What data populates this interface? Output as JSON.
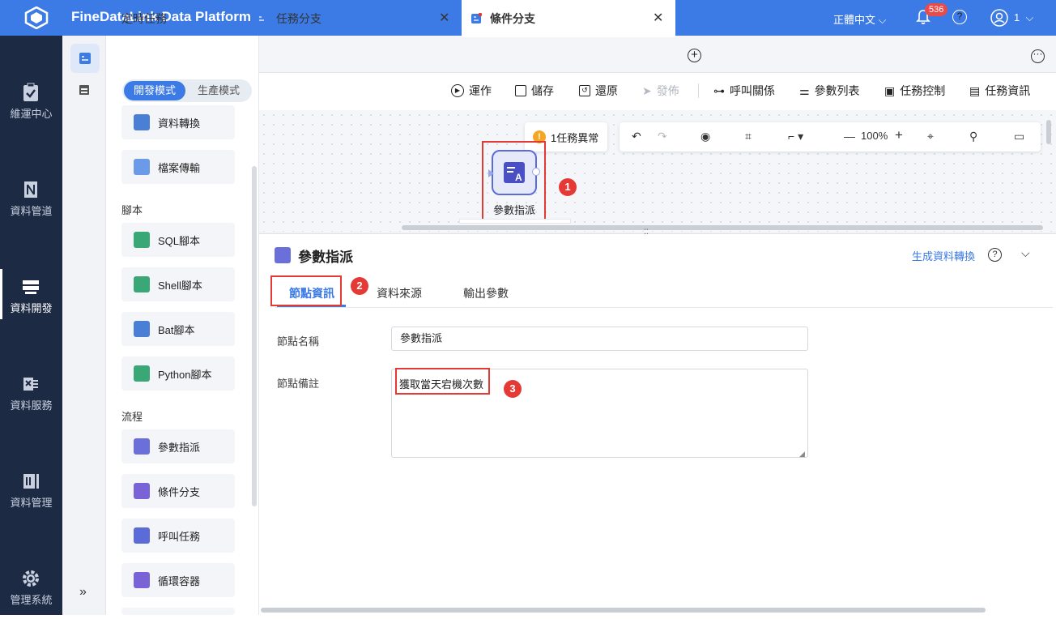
{
  "app": {
    "title": "FineDataLink Data Platform",
    "language": "正體中文",
    "notifications": "536",
    "user_number": "1"
  },
  "nav": [
    {
      "label": "維運中心",
      "icon": "clipboard-check-icon"
    },
    {
      "label": "資料管道",
      "icon": "pipeline-icon"
    },
    {
      "label": "資料開發",
      "icon": "dev-icon"
    },
    {
      "label": "資料服務",
      "icon": "service-icon"
    },
    {
      "label": "資料管理",
      "icon": "data-manage-icon"
    },
    {
      "label": "管理系統",
      "icon": "gear-icon"
    }
  ],
  "tabs": {
    "scheduled": "定時任務",
    "tab1": "任務分支",
    "tab2": "條件分支"
  },
  "modes": {
    "dev": "開發模式",
    "prod": "生產模式"
  },
  "toolbar": {
    "run": "運作",
    "save": "儲存",
    "restore": "還原",
    "publish": "發佈",
    "call_relation": "呼叫關係",
    "param_list": "參數列表",
    "task_control": "任務控制",
    "task_info": "任務資訊"
  },
  "palette": {
    "top": [
      "資料轉換",
      "檔案傳輸"
    ],
    "script_section": "腳本",
    "scripts": [
      "SQL腳本",
      "Shell腳本",
      "Bat腳本",
      "Python腳本"
    ],
    "flow_section": "流程",
    "flows": [
      "參數指派",
      "條件分支",
      "呼叫任務",
      "循環容器"
    ]
  },
  "canvas": {
    "warning": "1任務異常",
    "zoom": "100%",
    "node_label": "參數指派"
  },
  "markers": [
    "1",
    "2",
    "3"
  ],
  "panel": {
    "title": "參數指派",
    "generate": "生成資料轉換",
    "tabs": [
      "節點資訊",
      "資料來源",
      "輸出參數"
    ],
    "name_label": "節點名稱",
    "name_value": "參數指派",
    "note_label": "節點備註",
    "note_value": "獲取當天宕機次數"
  },
  "colors": {
    "primary": "#3c7ae5",
    "nav_bg": "#1d2a44",
    "highlight": "#e53935"
  }
}
